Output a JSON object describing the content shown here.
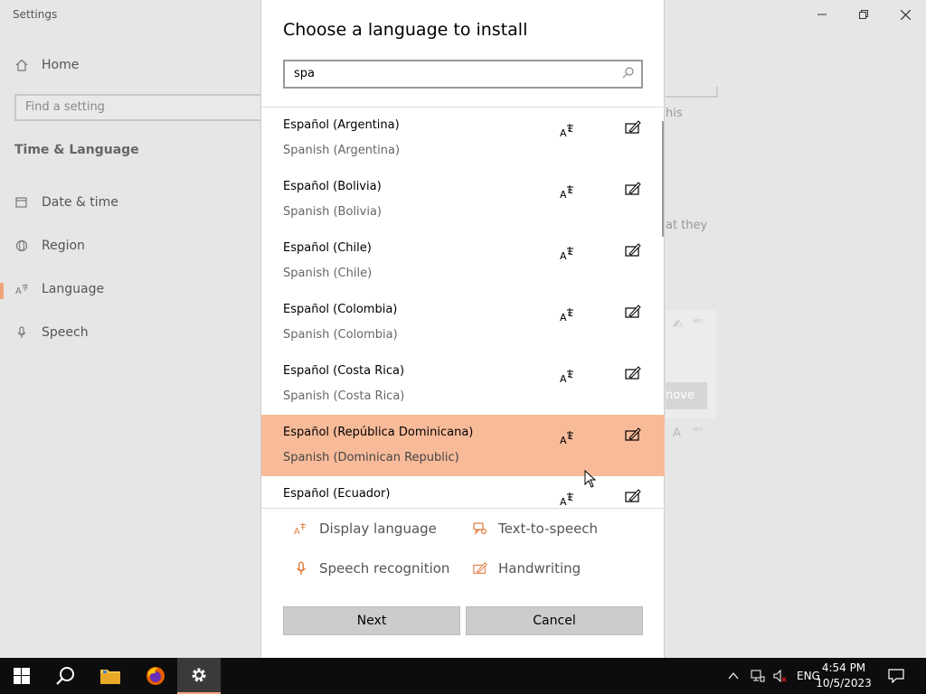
{
  "window": {
    "title": "Settings",
    "controls": [
      "minimize",
      "restore",
      "close"
    ]
  },
  "sidebar": {
    "home_label": "Home",
    "search_placeholder": "Find a setting",
    "section_title": "Time & Language",
    "items": [
      {
        "label": "Date & time",
        "icon": "calendar-clock-icon"
      },
      {
        "label": "Region",
        "icon": "globe-icon"
      },
      {
        "label": "Language",
        "icon": "language-icon",
        "selected": true
      },
      {
        "label": "Speech",
        "icon": "microphone-icon"
      }
    ]
  },
  "background_fragments": {
    "frag1": "his",
    "frag2": "at they",
    "frag3": "nove"
  },
  "dialog": {
    "title": "Choose a language to install",
    "search_value": "spa",
    "languages": [
      {
        "name": "Español (Argentina)",
        "english": "Spanish (Argentina)"
      },
      {
        "name": "Español (Bolivia)",
        "english": "Spanish (Bolivia)"
      },
      {
        "name": "Español (Chile)",
        "english": "Spanish (Chile)"
      },
      {
        "name": "Español (Colombia)",
        "english": "Spanish (Colombia)"
      },
      {
        "name": "Español (Costa Rica)",
        "english": "Spanish (Costa Rica)"
      },
      {
        "name": "Español (República Dominicana)",
        "english": "Spanish (Dominican Republic)",
        "highlighted": true
      },
      {
        "name": "Español (Ecuador)",
        "english": ""
      }
    ],
    "legend": {
      "display_language": "Display language",
      "text_to_speech": "Text-to-speech",
      "speech_recognition": "Speech recognition",
      "handwriting": "Handwriting"
    },
    "next_label": "Next",
    "cancel_label": "Cancel"
  },
  "taskbar": {
    "apps": [
      "start",
      "search",
      "file-explorer",
      "firefox",
      "settings"
    ],
    "lang": "ENG",
    "time": "4:54 PM",
    "date": "10/5/2023"
  },
  "colors": {
    "accent": "#e07a3c",
    "highlight": "#f8bb99"
  }
}
